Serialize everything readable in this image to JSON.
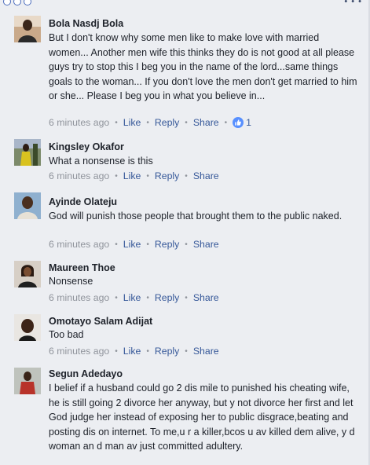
{
  "comments": [
    {
      "name": "Bola Nasdj Bola",
      "text": "But I don't know why some men like to make love with married women... Another men wife this thinks they do is not good at all please guys try to stop this I beg you in the name of the lord...same things goals to the woman... If you don't love the men don't get married to him or she... Please I beg you in what you believe in...",
      "time": "6 minutes ago",
      "like_label": "Like",
      "reply_label": "Reply",
      "share_label": "Share",
      "reaction_count": "1"
    },
    {
      "name": "Kingsley Okafor",
      "text": "What a nonsense is this",
      "time": "6 minutes ago",
      "like_label": "Like",
      "reply_label": "Reply",
      "share_label": "Share"
    },
    {
      "name": "Ayinde Olateju",
      "text": "God will punish those people that brought them to the public naked.",
      "time": "6 minutes ago",
      "like_label": "Like",
      "reply_label": "Reply",
      "share_label": "Share"
    },
    {
      "name": "Maureen Thoe",
      "text": "Nonsense",
      "time": "6 minutes ago",
      "like_label": "Like",
      "reply_label": "Reply",
      "share_label": "Share"
    },
    {
      "name": "Omotayo Salam Adijat",
      "text": "Too bad",
      "time": "6 minutes ago",
      "like_label": "Like",
      "reply_label": "Reply",
      "share_label": "Share"
    },
    {
      "name": "Segun Adedayo",
      "text": "I belief if a husband could go 2 dis mile to punished his cheating  wife, he is still going 2 divorce her anyway, but y not divorce her first and let God judge her instead of exposing her to public disgrace,beating and posting dis on internet. To me,u r a killer,bcos u av killed dem alive, y d woman an d man av just committed adultery."
    }
  ],
  "colors": {
    "background": "#eceef2",
    "link": "#365899",
    "muted": "#90949c",
    "text": "#1d2129",
    "like_badge": "#5890ff"
  },
  "icons": {
    "reaction": "thumbs-up-icon",
    "menu": "more-options-icon"
  }
}
